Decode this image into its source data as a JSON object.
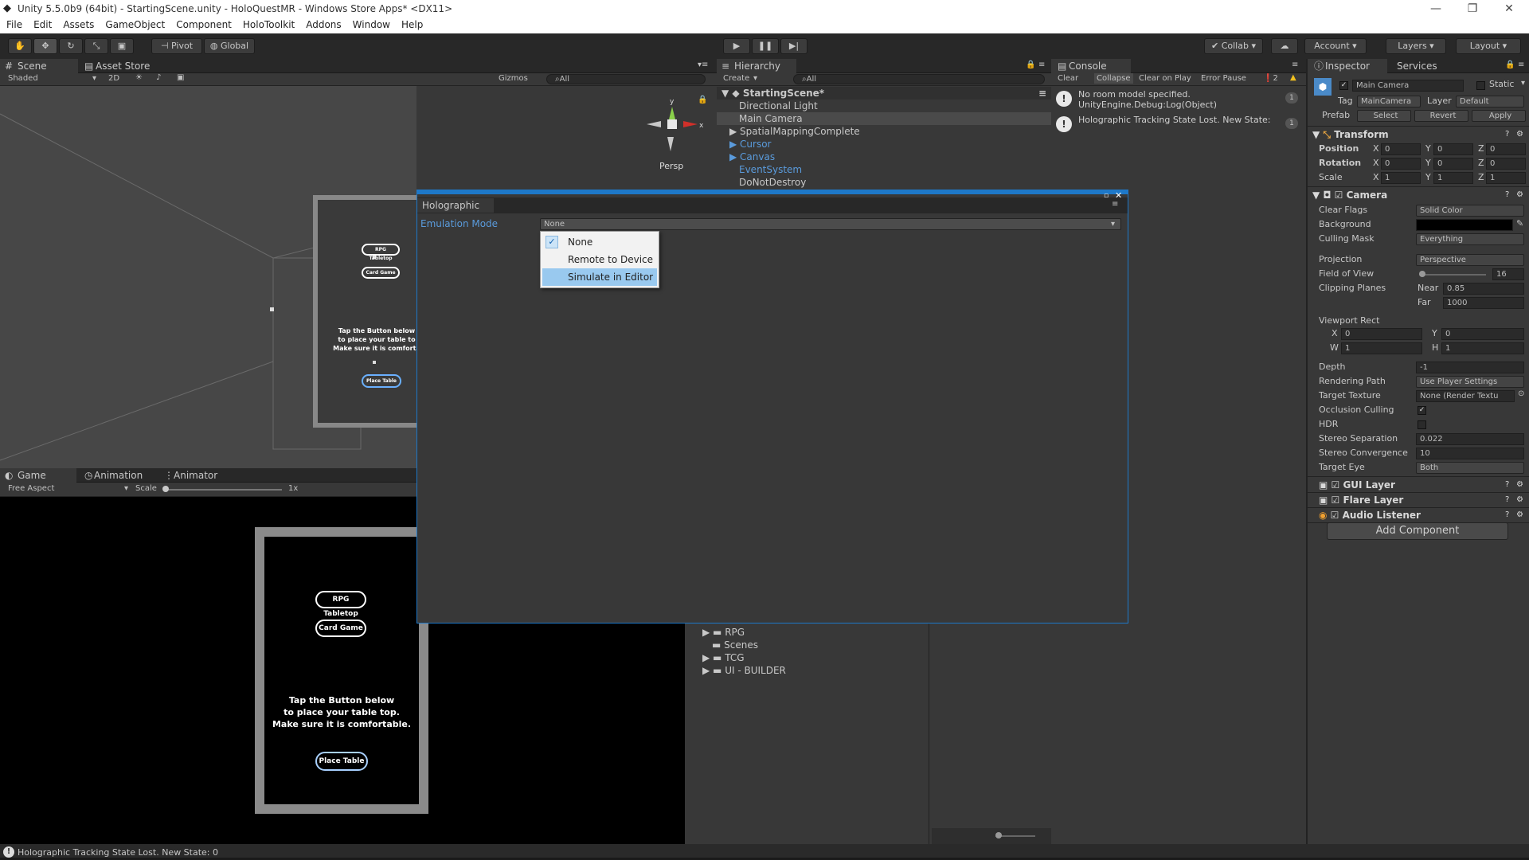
{
  "window": {
    "title": "Unity 5.5.0b9 (64bit) - StartingScene.unity - HoloQuestMR - Windows Store Apps* <DX11>"
  },
  "menubar": [
    "File",
    "Edit",
    "Assets",
    "GameObject",
    "Component",
    "HoloToolkit",
    "Addons",
    "Window",
    "Help"
  ],
  "toolbar": {
    "pivot": "Pivot",
    "global": "Global",
    "collab": "Collab",
    "account": "Account",
    "layers": "Layers",
    "layout": "Layout"
  },
  "scene": {
    "tab": "Scene",
    "tab2": "Asset Store",
    "shaded": "Shaded",
    "mode2d": "2D",
    "gizmos": "Gizmos",
    "search": "All",
    "persp": "Persp",
    "btn_rpg": "RPG Tabletop",
    "btn_card": "Card Game",
    "instr1": "Tap the Button below",
    "instr2": "to place your table to",
    "instr3": "Make sure it is comforta",
    "place": "Place Table"
  },
  "game": {
    "tab": "Game",
    "tab2": "Animation",
    "tab3": "Animator",
    "aspect": "Free Aspect",
    "scale_label": "Scale",
    "scale_val": "1x",
    "btn_rpg": "RPG Tabletop",
    "btn_card": "Card Game",
    "instr1": "Tap the Button below",
    "instr2": "to place your table top.",
    "instr3": "Make sure it is comfortable.",
    "place": "Place Table"
  },
  "hierarchy": {
    "tab": "Hierarchy",
    "create": "Create",
    "search": "All",
    "scene": "StartingScene*",
    "items": [
      "Directional Light",
      "Main Camera",
      "SpatialMappingComplete",
      "Cursor",
      "Canvas",
      "EventSystem",
      "DoNotDestroy"
    ]
  },
  "project": {
    "folders": [
      "RPG",
      "Scenes",
      "TCG",
      "UI - BUILDER"
    ]
  },
  "console": {
    "tab": "Console",
    "clear": "Clear",
    "collapse": "Collapse",
    "clear_on_play": "Clear on Play",
    "error_pause": "Error Pause",
    "count": "2",
    "msg1a": "No room model specified.",
    "msg1b": "UnityEngine.Debug:Log(Object)",
    "msg1n": "1",
    "msg2": "Holographic Tracking State Lost. New State:",
    "msg2n": "1"
  },
  "holographic": {
    "tab": "Holographic",
    "label": "Emulation Mode",
    "value": "None",
    "options": [
      "None",
      "Remote to Device",
      "Simulate in Editor"
    ],
    "checked": "None",
    "highlighted": "Simulate in Editor"
  },
  "inspector": {
    "tab": "Inspector",
    "tab2": "Services",
    "name": "Main Camera",
    "static": "Static",
    "tag_label": "Tag",
    "tag": "MainCamera",
    "layer_label": "Layer",
    "layer": "Default",
    "prefab_label": "Prefab",
    "select": "Select",
    "revert": "Revert",
    "apply": "Apply",
    "transform": "Transform",
    "position": {
      "label": "Position",
      "x": "0",
      "y": "0",
      "z": "0"
    },
    "rotation": {
      "label": "Rotation",
      "x": "0",
      "y": "0",
      "z": "0"
    },
    "scale": {
      "label": "Scale",
      "x": "1",
      "y": "1",
      "z": "1"
    },
    "camera": "Camera",
    "clear_flags": {
      "label": "Clear Flags",
      "value": "Solid Color"
    },
    "background": {
      "label": "Background",
      "color": "#000000"
    },
    "culling": {
      "label": "Culling Mask",
      "value": "Everything"
    },
    "projection": {
      "label": "Projection",
      "value": "Perspective"
    },
    "fov": {
      "label": "Field of View",
      "value": "16"
    },
    "clipping": {
      "label": "Clipping Planes",
      "near_label": "Near",
      "near": "0.85",
      "far_label": "Far",
      "far": "1000"
    },
    "viewport": {
      "label": "Viewport Rect",
      "x": "0",
      "y": "0",
      "w": "1",
      "h": "1"
    },
    "depth": {
      "label": "Depth",
      "value": "-1"
    },
    "rendering": {
      "label": "Rendering Path",
      "value": "Use Player Settings"
    },
    "target_tex": {
      "label": "Target Texture",
      "value": "None (Render Textu"
    },
    "occlusion": {
      "label": "Occlusion Culling"
    },
    "hdr": {
      "label": "HDR"
    },
    "stereo_sep": {
      "label": "Stereo Separation",
      "value": "0.022"
    },
    "stereo_conv": {
      "label": "Stereo Convergence",
      "value": "10"
    },
    "target_eye": {
      "label": "Target Eye",
      "value": "Both"
    },
    "gui_layer": "GUI Layer",
    "flare_layer": "Flare Layer",
    "audio_listener": "Audio Listener",
    "add_component": "Add Component"
  },
  "status": {
    "text": "Holographic Tracking State Lost. New State: 0"
  }
}
